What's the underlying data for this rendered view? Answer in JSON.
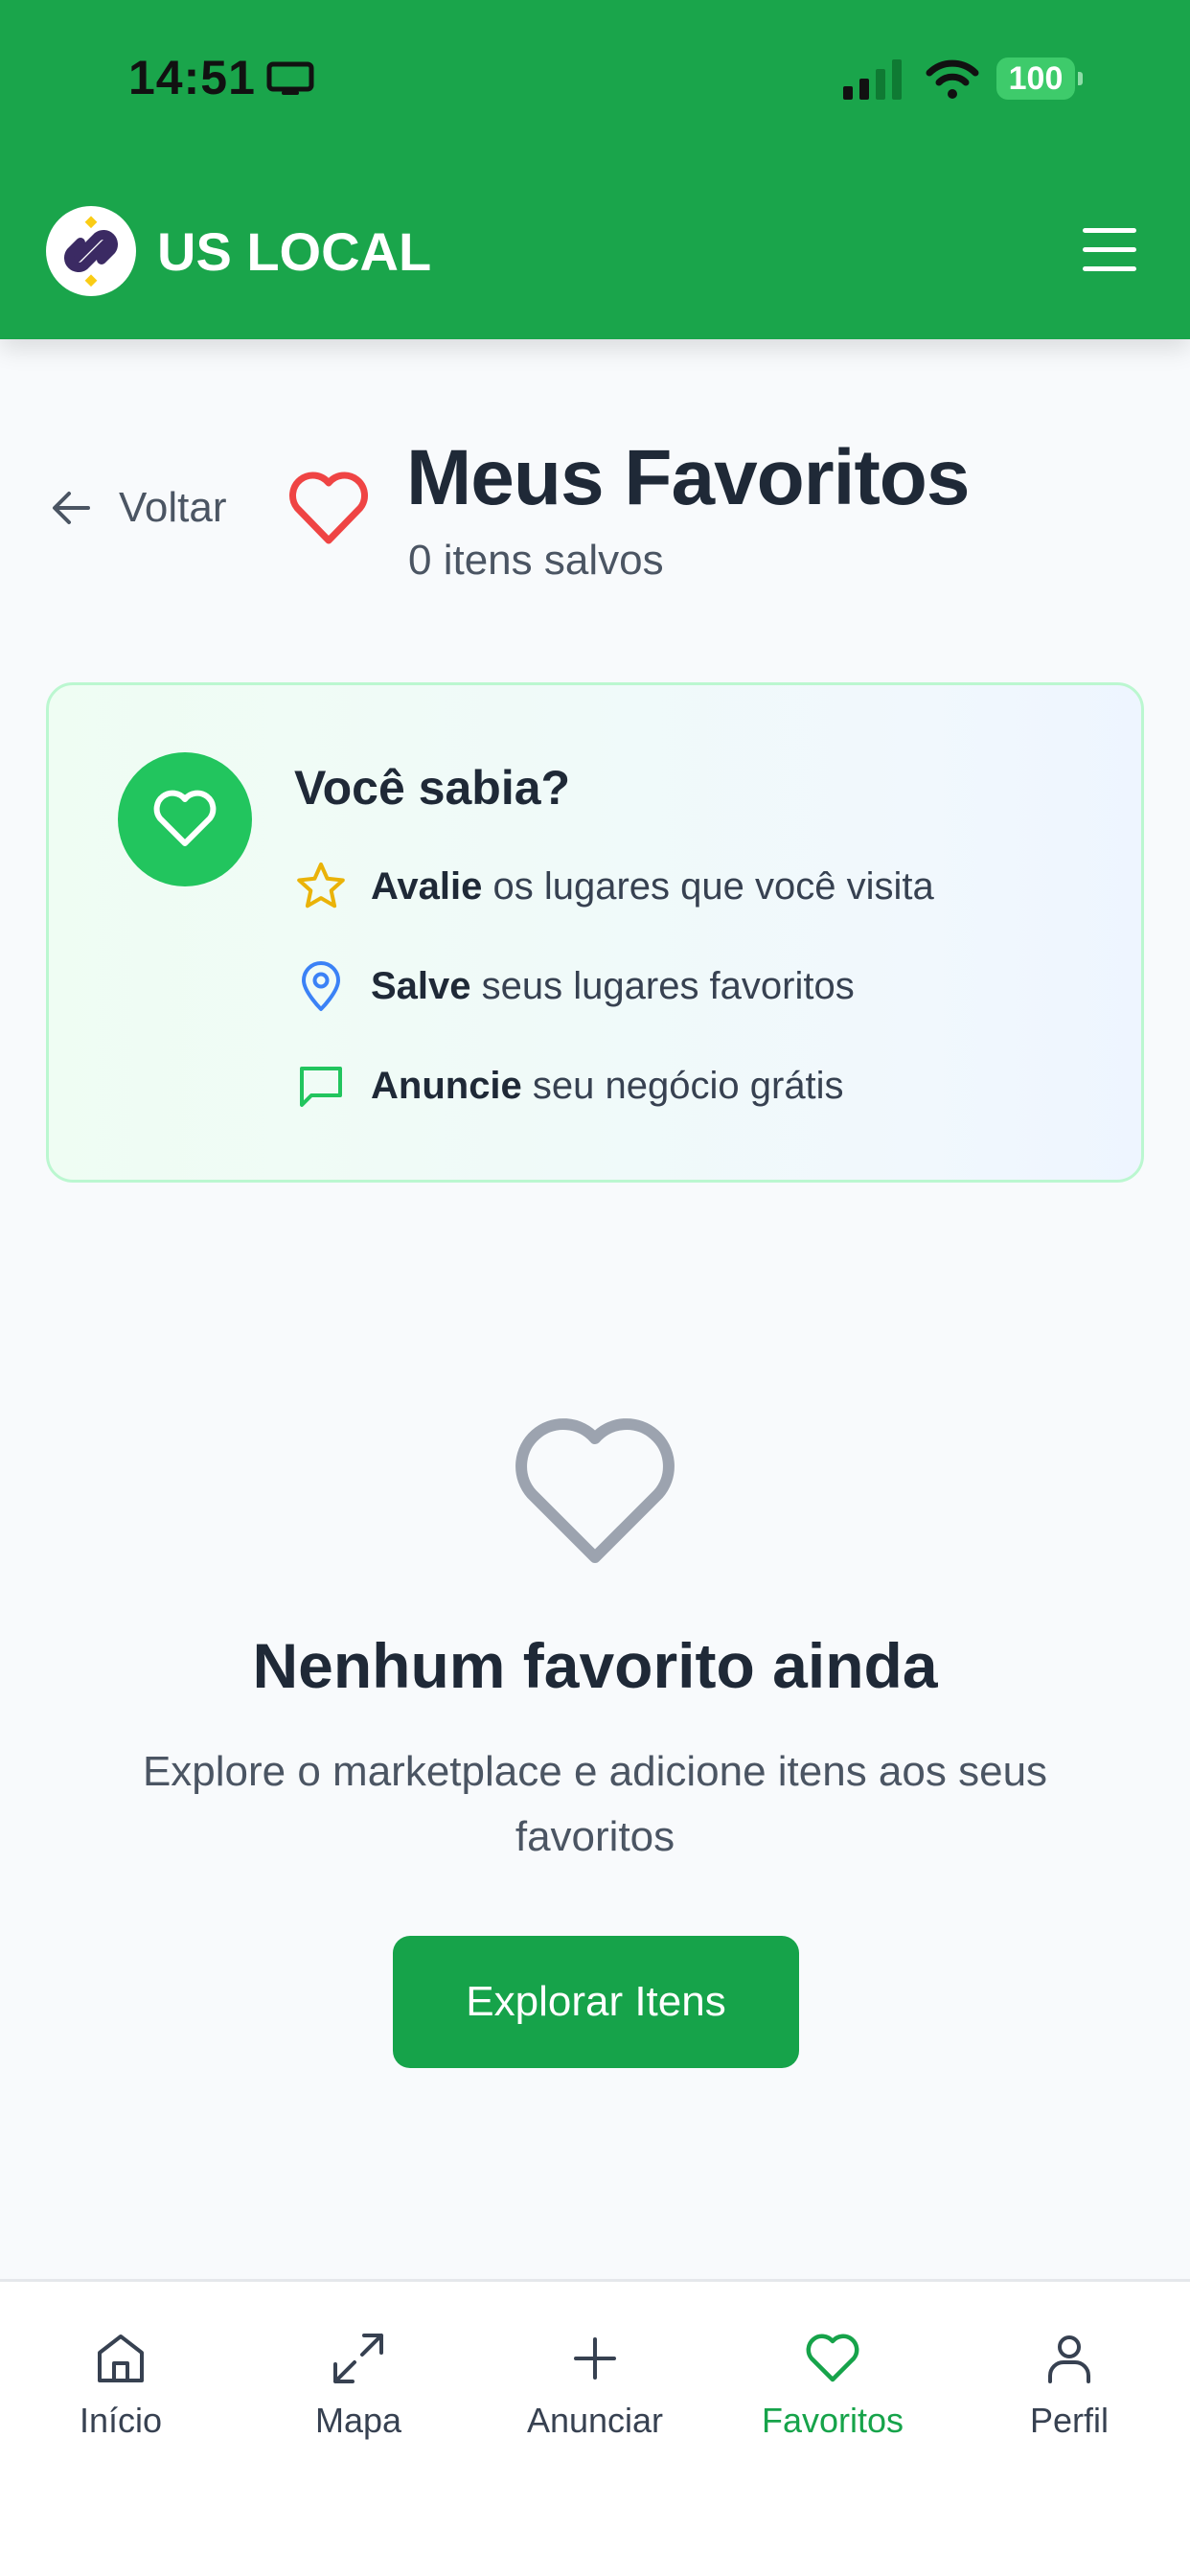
{
  "status_bar": {
    "time": "14:51",
    "battery": "100"
  },
  "header": {
    "brand": "US LOCAL"
  },
  "page": {
    "back_label": "Voltar",
    "title": "Meus Favoritos",
    "subtitle": "0 itens salvos"
  },
  "tip_card": {
    "title": "Você sabia?",
    "items": [
      {
        "bold": "Avalie",
        "text": " os lugares que você visita",
        "icon": "star-icon",
        "color": "#eab308"
      },
      {
        "bold": "Salve",
        "text": " seus lugares favoritos",
        "icon": "map-pin-icon",
        "color": "#3b82f6"
      },
      {
        "bold": "Anuncie",
        "text": " seu negócio grátis",
        "icon": "message-square-icon",
        "color": "#22c55e"
      }
    ]
  },
  "empty_state": {
    "title": "Nenhum favorito ainda",
    "description": "Explore o marketplace e adicione itens aos seus favoritos",
    "button_label": "Explorar Itens"
  },
  "tabbar": {
    "items": [
      {
        "label": "Início",
        "icon": "home-icon",
        "active": false
      },
      {
        "label": "Mapa",
        "icon": "expand-arrows-icon",
        "active": false
      },
      {
        "label": "Anunciar",
        "icon": "plus-icon",
        "active": false
      },
      {
        "label": "Favoritos",
        "icon": "heart-icon",
        "active": true
      },
      {
        "label": "Perfil",
        "icon": "user-icon",
        "active": false
      }
    ]
  },
  "colors": {
    "primary": "#1aa54b",
    "button": "#16a34a",
    "active_tab": "#16a34a",
    "title_heart": "#ef4444",
    "empty_heart": "#9ca3af"
  }
}
